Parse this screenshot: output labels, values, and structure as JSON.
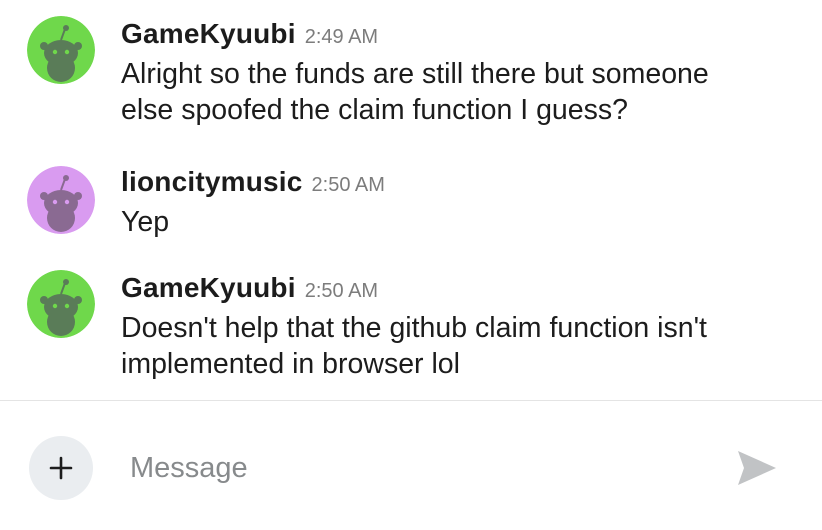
{
  "messages": [
    {
      "username": "GameKyuubi",
      "time": "2:49 AM",
      "text": "Alright so the funds are still there but someone\nelse spoofed the claim function I guess?",
      "avatar_color": "#6fd84b"
    },
    {
      "username": "lioncitymusic",
      "time": "2:50 AM",
      "text": "Yep",
      "avatar_color": "#d99bf0"
    },
    {
      "username": "GameKyuubi",
      "time": "2:50 AM",
      "text": "Doesn't help that the github claim function isn't\nimplemented in browser lol",
      "avatar_color": "#6fd84b"
    }
  ],
  "composer": {
    "placeholder": "Message",
    "add_icon": "plus-icon",
    "send_icon": "send-icon"
  },
  "colors": {
    "text": "#1c1c1c",
    "timestamp": "#7c7c7c",
    "divider": "#e4e4e4",
    "add_button_bg": "#eaedf0",
    "send_icon": "#c1c3c5"
  }
}
